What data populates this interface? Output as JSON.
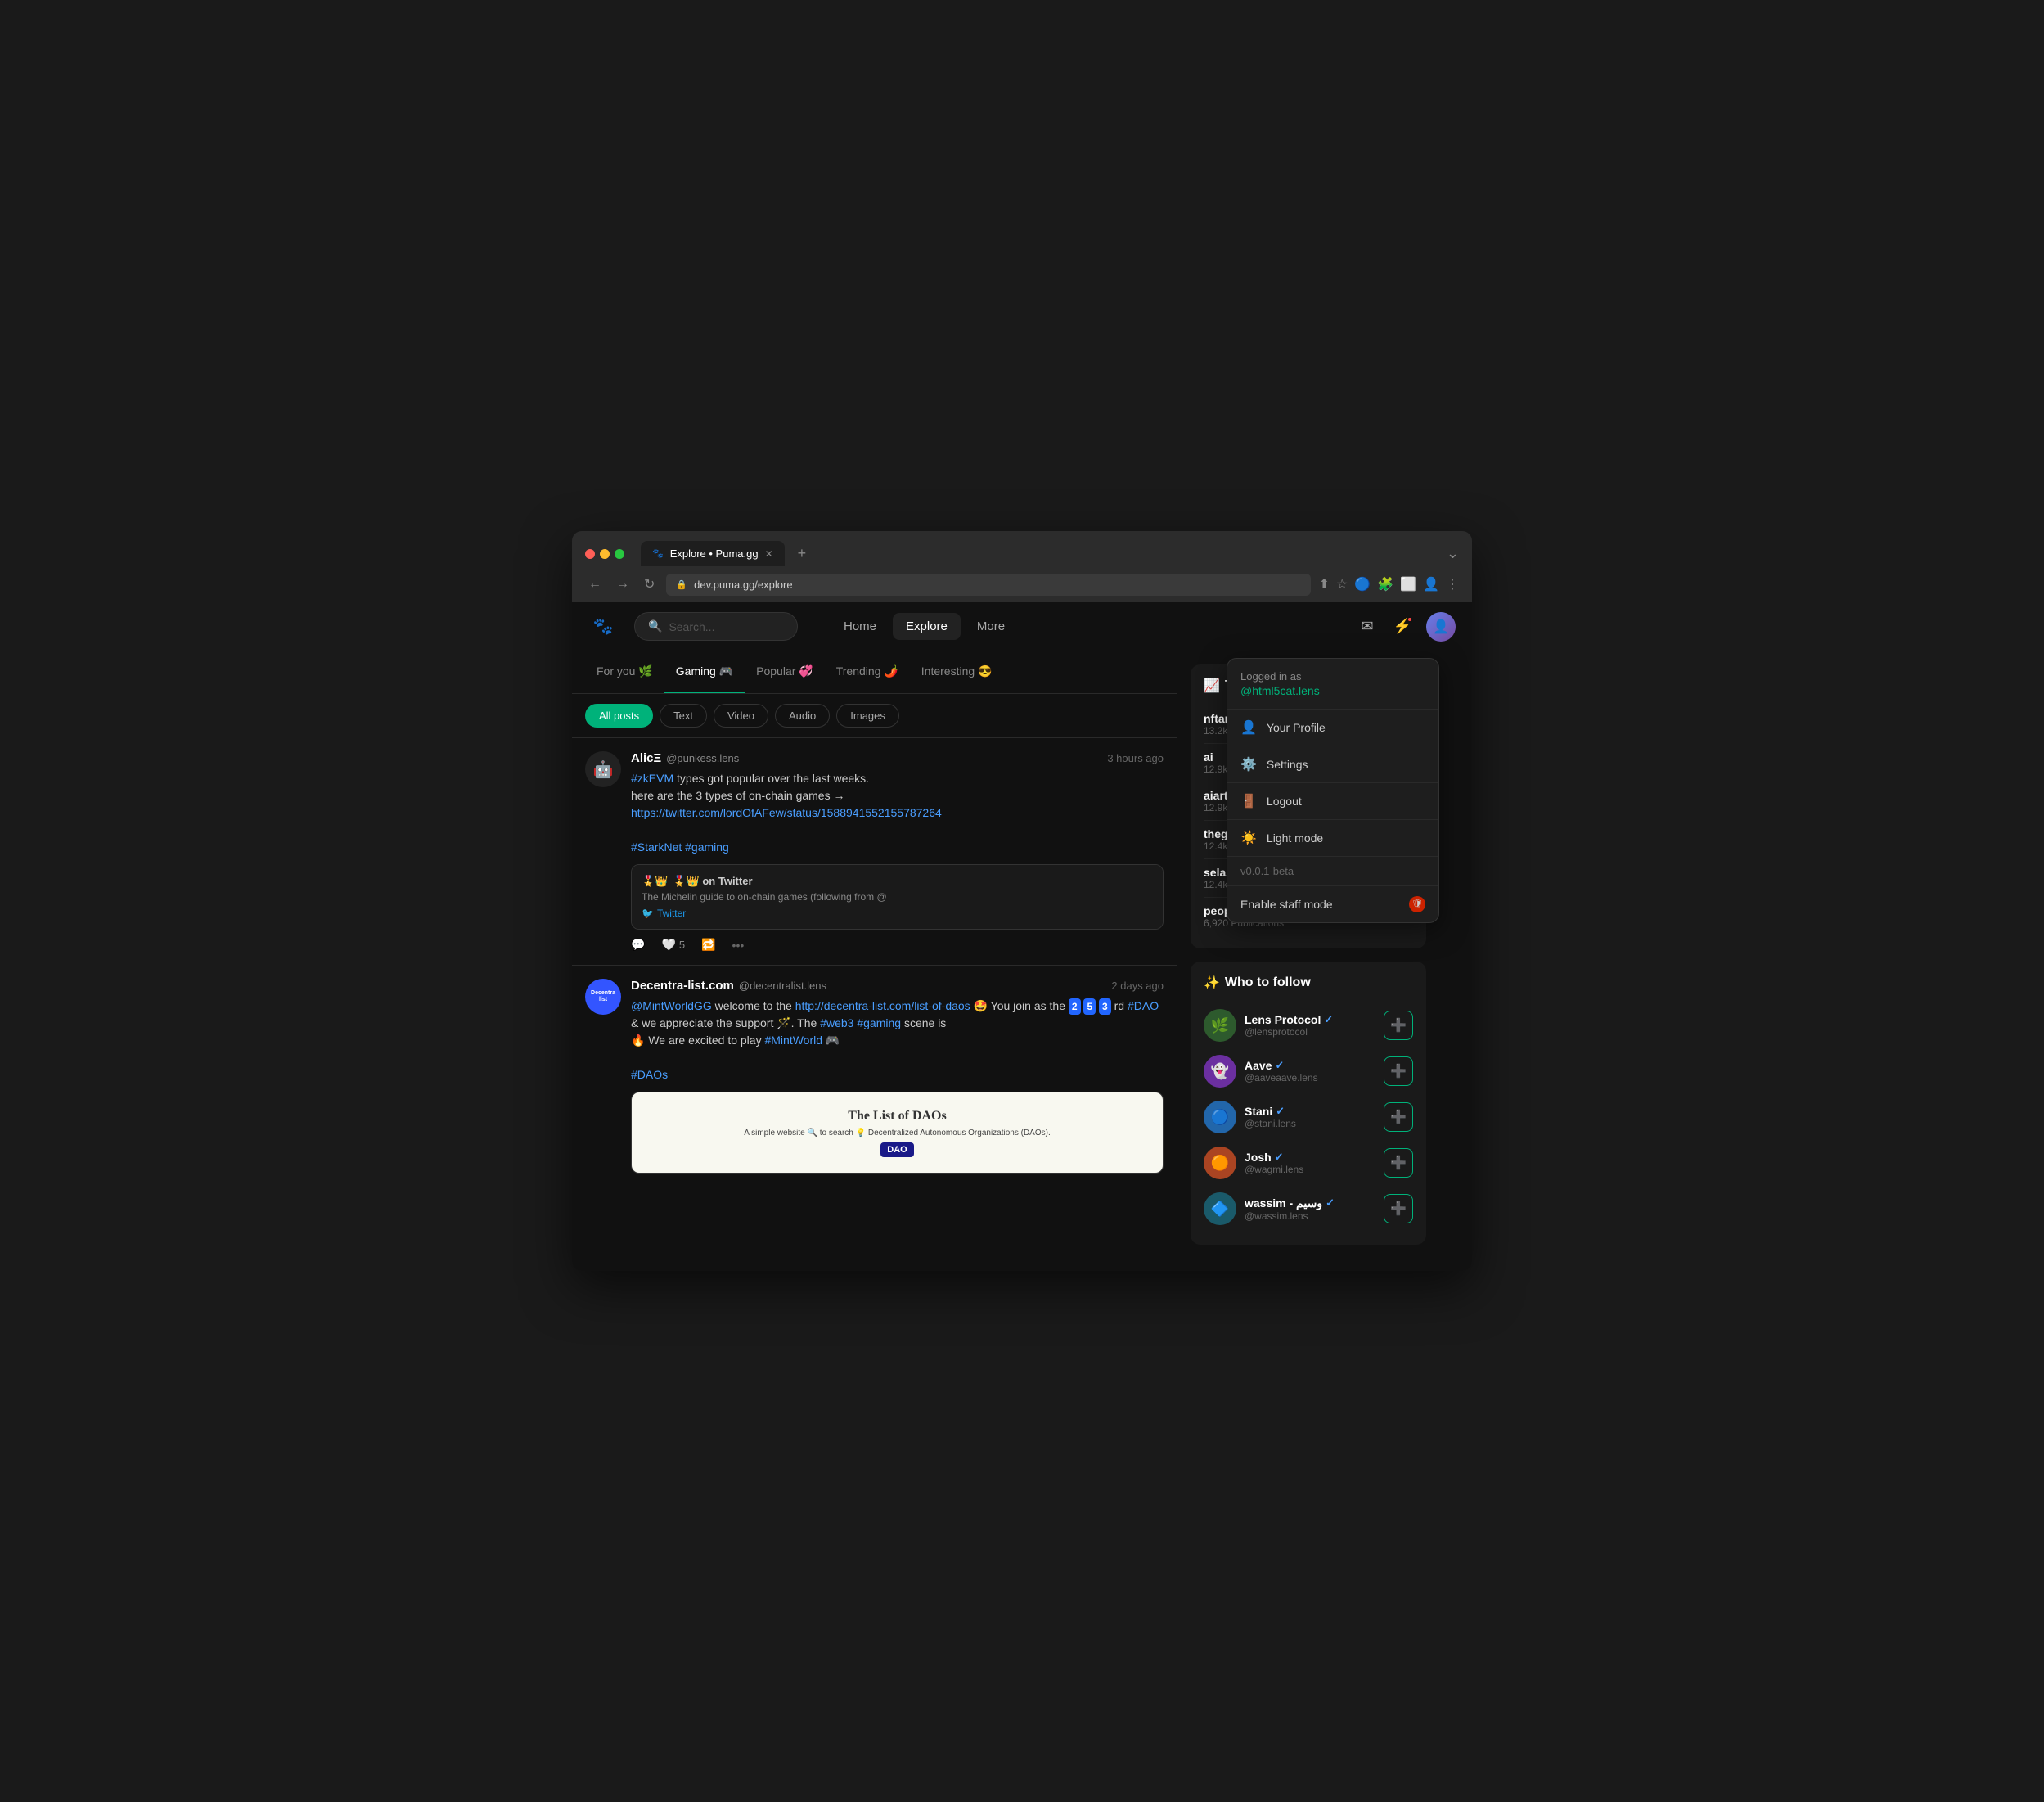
{
  "browser": {
    "tab_title": "Explore • Puma.gg",
    "url": "dev.puma.gg/explore",
    "add_tab_label": "+",
    "nav_back": "←",
    "nav_forward": "→",
    "nav_refresh": "↻"
  },
  "header": {
    "logo": "🐾",
    "search_placeholder": "Search...",
    "nav_items": [
      {
        "label": "Home",
        "active": false
      },
      {
        "label": "Explore",
        "active": true
      },
      {
        "label": "More",
        "active": false
      }
    ],
    "mail_icon": "✉",
    "bolt_icon": "⚡",
    "avatar": "👤"
  },
  "feed": {
    "tabs": [
      {
        "label": "For you",
        "emoji": "🌿",
        "active": false
      },
      {
        "label": "Gaming",
        "emoji": "🎮",
        "active": true
      },
      {
        "label": "Popular",
        "emoji": "💞",
        "active": false
      },
      {
        "label": "Trending",
        "emoji": "🌶️",
        "active": false
      },
      {
        "label": "Interesting",
        "emoji": "😎",
        "active": false
      }
    ],
    "filter_pills": [
      {
        "label": "All posts",
        "active": true
      },
      {
        "label": "Text",
        "active": false
      },
      {
        "label": "Video",
        "active": false
      },
      {
        "label": "Audio",
        "active": false
      },
      {
        "label": "Images",
        "active": false
      }
    ],
    "posts": [
      {
        "id": "post-1",
        "author_name": "AlicΞ",
        "author_handle": "@punkess.lens",
        "time_ago": "3 hours ago",
        "avatar_emoji": "🤖",
        "text_parts": [
          {
            "type": "hashtag",
            "text": "#zkEVM"
          },
          {
            "type": "text",
            "text": " types got popular over the last weeks.\nhere are the 3 types of on-chain games →\nhttps://twitter.com/lordOfAFew/status/1588941552155787264"
          },
          {
            "type": "newline"
          },
          {
            "type": "hashtag",
            "text": "#StarkNet"
          },
          {
            "type": "text",
            "text": " "
          },
          {
            "type": "hashtag",
            "text": "#gaming"
          }
        ],
        "embed": {
          "title": "🎖️👑 on Twitter",
          "description": "The Michelin guide to on-chain games (following from @",
          "source": "Twitter"
        },
        "actions": {
          "comment_icon": "💬",
          "like_icon": "🤍",
          "like_count": "5",
          "share_icon": "🔁",
          "more_icon": "..."
        }
      },
      {
        "id": "post-2",
        "author_name": "Decentra-list.com",
        "author_handle": "@decentralist.lens",
        "time_ago": "2 days ago",
        "avatar_label": "Decentra list",
        "text": "@MintWorldGG welcome to the http://decentra-list.com/list-of-daos 🤩 You join as the 2️⃣5️⃣3️⃣rd #DAO & we appreciate the support 🪄. The #web3 #gaming scene is 🔥 We are excited to play #MintWorld 🎮",
        "hashtags": [
          "#DAOs"
        ],
        "image_preview": {
          "title": "The List of DAOs",
          "subtitle": "A simple website 🔍 to search 💡 Decentralized Autonomous Organizations (DAOs).",
          "badge": "DAO"
        }
      }
    ]
  },
  "sidebar": {
    "trending_title": "Trending",
    "trending_icon": "📈",
    "trending_items": [
      {
        "name": "nftart",
        "count": "13.2k Publications"
      },
      {
        "name": "ai",
        "count": "12.9k Publications"
      },
      {
        "name": "aiart",
        "count": "12.9k Publications"
      },
      {
        "name": "thegallerydao",
        "count": "12.4k Publications"
      },
      {
        "name": "selas studio",
        "count": "12.4k Publications"
      },
      {
        "name": "people",
        "count": "6,920 Publications"
      }
    ],
    "follow_title": "Who to follow",
    "follow_icon": "✨",
    "follow_items": [
      {
        "name": "Lens Protocol",
        "handle": "@lensprotocol",
        "emoji": "🌿",
        "verified": true,
        "av_class": "av-lens"
      },
      {
        "name": "Aave",
        "handle": "@aaveaave.lens",
        "emoji": "👻",
        "verified": true,
        "av_class": "av-aave"
      },
      {
        "name": "Stani",
        "handle": "@stani.lens",
        "emoji": "🔵",
        "verified": true,
        "av_class": "av-stani"
      },
      {
        "name": "Josh",
        "handle": "@wagmi.lens",
        "emoji": "🟠",
        "verified": true,
        "av_class": "av-josh"
      },
      {
        "name": "wassim - وسيم",
        "handle": "@wassim.lens",
        "emoji": "🔷",
        "verified": true,
        "av_class": "av-wassim"
      }
    ]
  },
  "dropdown": {
    "logged_in_label": "Logged in as",
    "username": "@html5cat.lens",
    "menu_items": [
      {
        "label": "Your Profile",
        "icon": "👤"
      },
      {
        "label": "Settings",
        "icon": "⚙️"
      },
      {
        "label": "Logout",
        "icon": "🚪"
      }
    ],
    "light_mode_label": "Light mode",
    "light_mode_icon": "☀️",
    "version": "v0.0.1-beta",
    "staff_mode_label": "Enable staff mode",
    "staff_icon": "🛡️"
  }
}
